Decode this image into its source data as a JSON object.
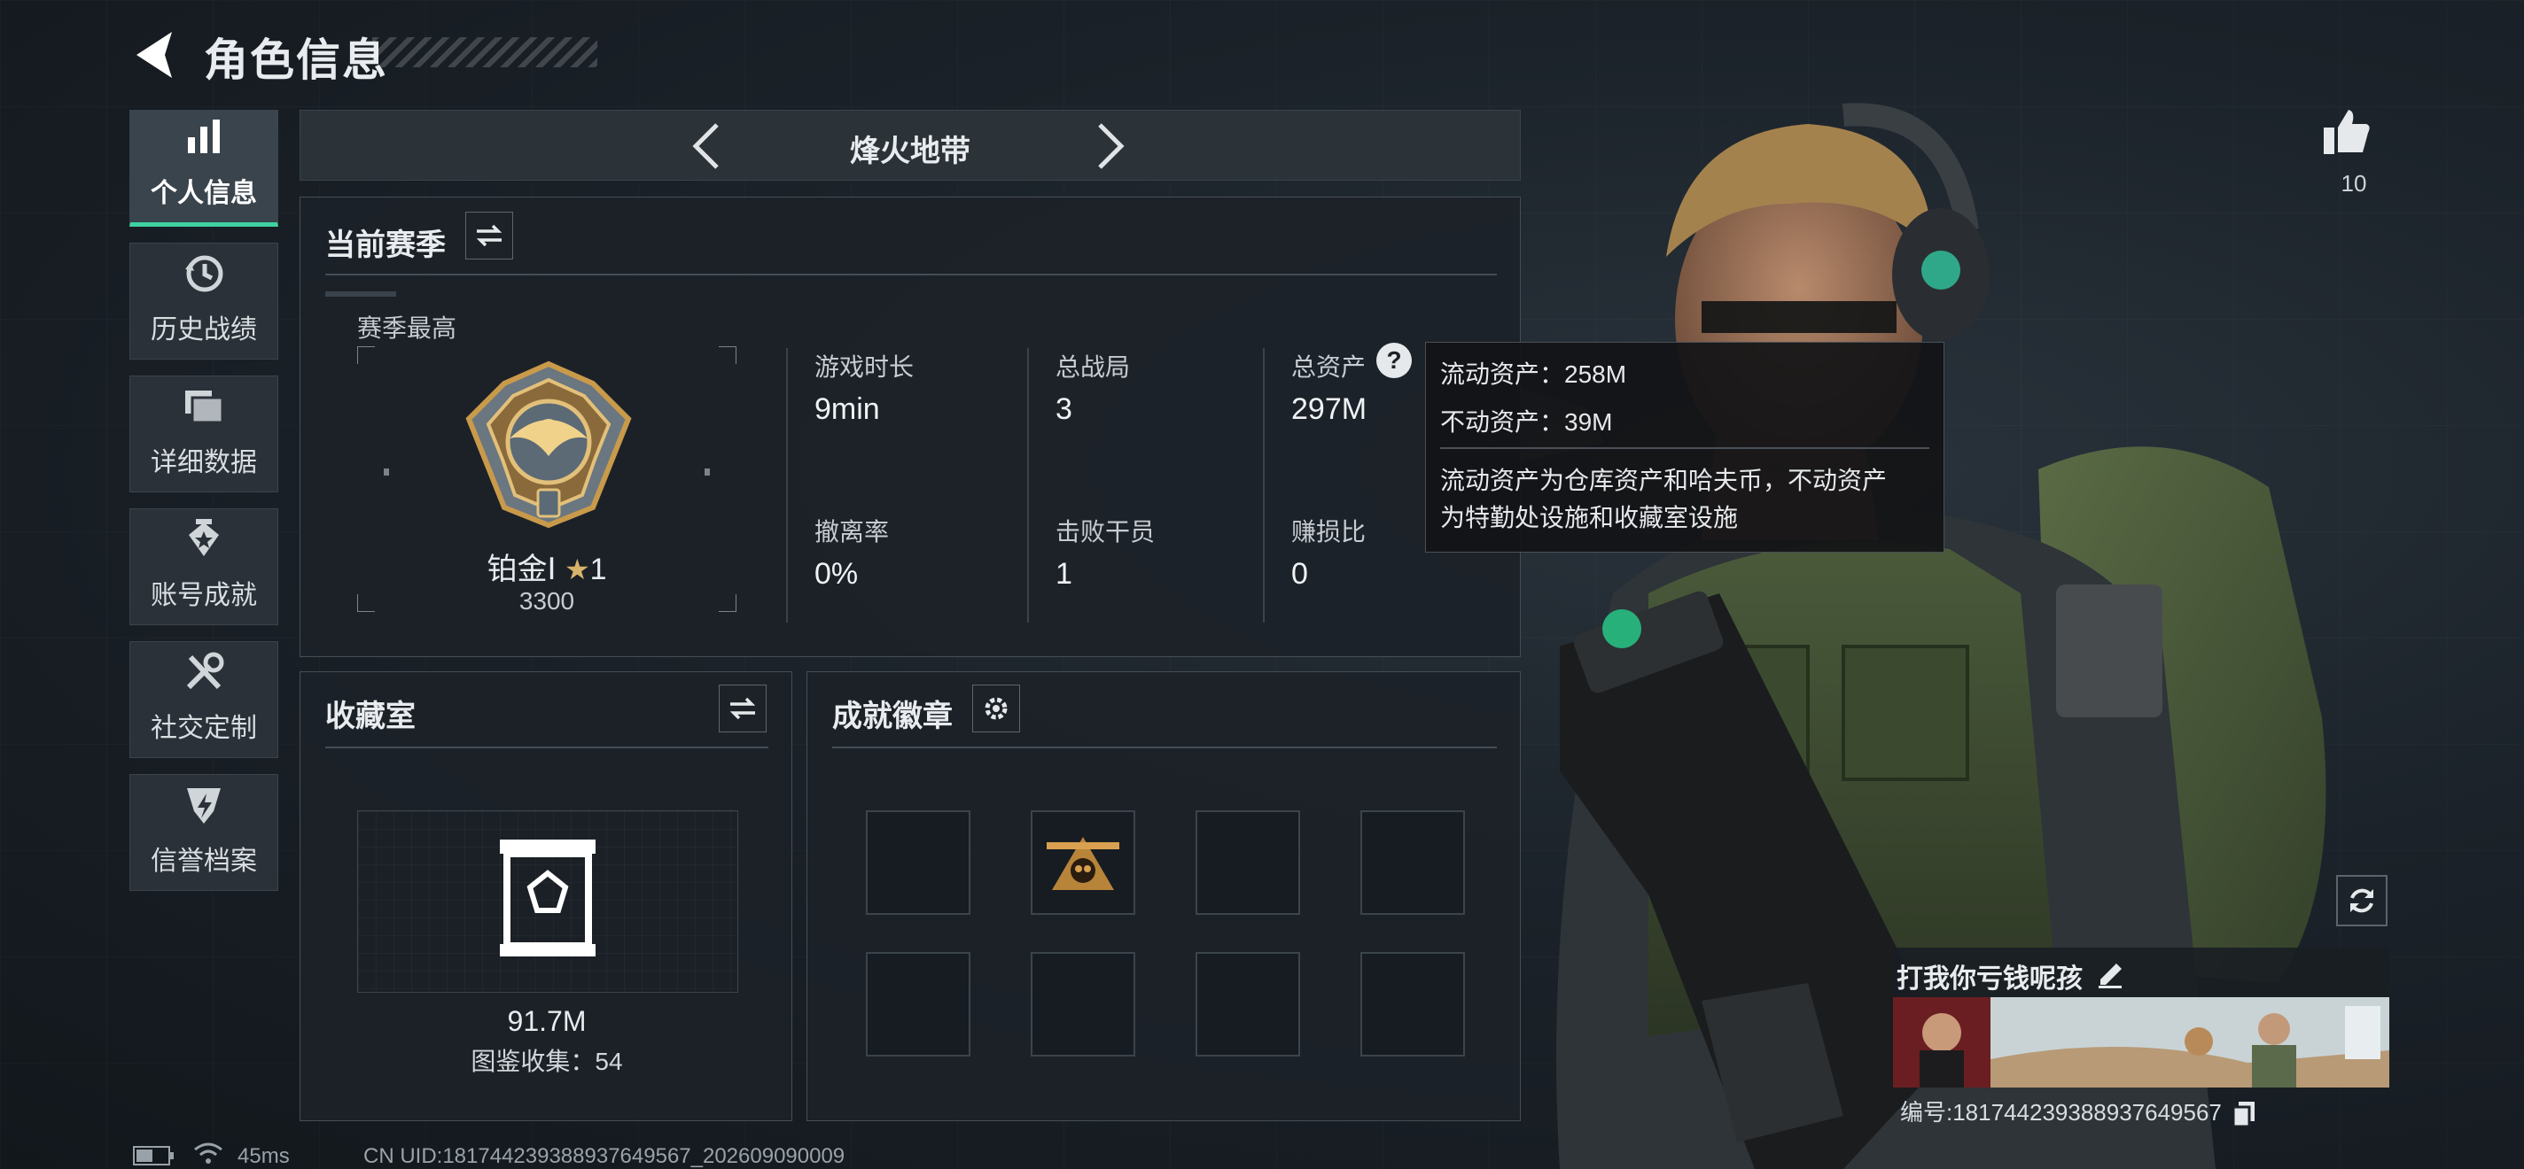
{
  "header": {
    "title": "角色信息"
  },
  "sidebar": {
    "items": [
      {
        "label": "个人信息",
        "icon": "bar-chart-icon",
        "active": true
      },
      {
        "label": "历史战绩",
        "icon": "history-clock-icon",
        "active": false
      },
      {
        "label": "详细数据",
        "icon": "folder-icon",
        "active": false
      },
      {
        "label": "账号成就",
        "icon": "achievement-icon",
        "active": false
      },
      {
        "label": "社交定制",
        "icon": "tools-icon",
        "active": false
      },
      {
        "label": "信誉档案",
        "icon": "lightning-shield-icon",
        "active": false
      }
    ]
  },
  "mode": {
    "name": "烽火地带"
  },
  "season": {
    "title": "当前赛季",
    "highest_label": "赛季最高",
    "rank_name": "铂金Ⅰ",
    "rank_stars": "1",
    "rank_score": "3300",
    "stats": [
      {
        "label": "游戏时长",
        "value": "9min"
      },
      {
        "label": "总战局",
        "value": "3"
      },
      {
        "label": "总资产",
        "value": "297M"
      },
      {
        "label": "撤离率",
        "value": "0%"
      },
      {
        "label": "击败干员",
        "value": "1"
      },
      {
        "label": "赚损比",
        "value": "0"
      }
    ]
  },
  "tooltip": {
    "line1": "流动资产：258M",
    "line2": "不动资产：39M",
    "desc1": "流动资产为仓库资产和哈夫币，不动资产",
    "desc2": "为特勤处设施和收藏室设施"
  },
  "collection": {
    "title": "收藏室",
    "value": "91.7M",
    "catalog": "图鉴收集：54"
  },
  "badges": {
    "title": "成就徽章",
    "filled_slot": 1,
    "slot_count": 8
  },
  "player": {
    "likes": "10",
    "nickname": "打我你亏钱呢孩",
    "id_text": "编号:181744239388937649567"
  },
  "status": {
    "ping": "45ms",
    "uid": "CN UID:181744239388937649567_202609090009"
  },
  "colors": {
    "accent": "#3fd2a0",
    "gold": "#c89a4a",
    "panel": "#1c2228"
  }
}
